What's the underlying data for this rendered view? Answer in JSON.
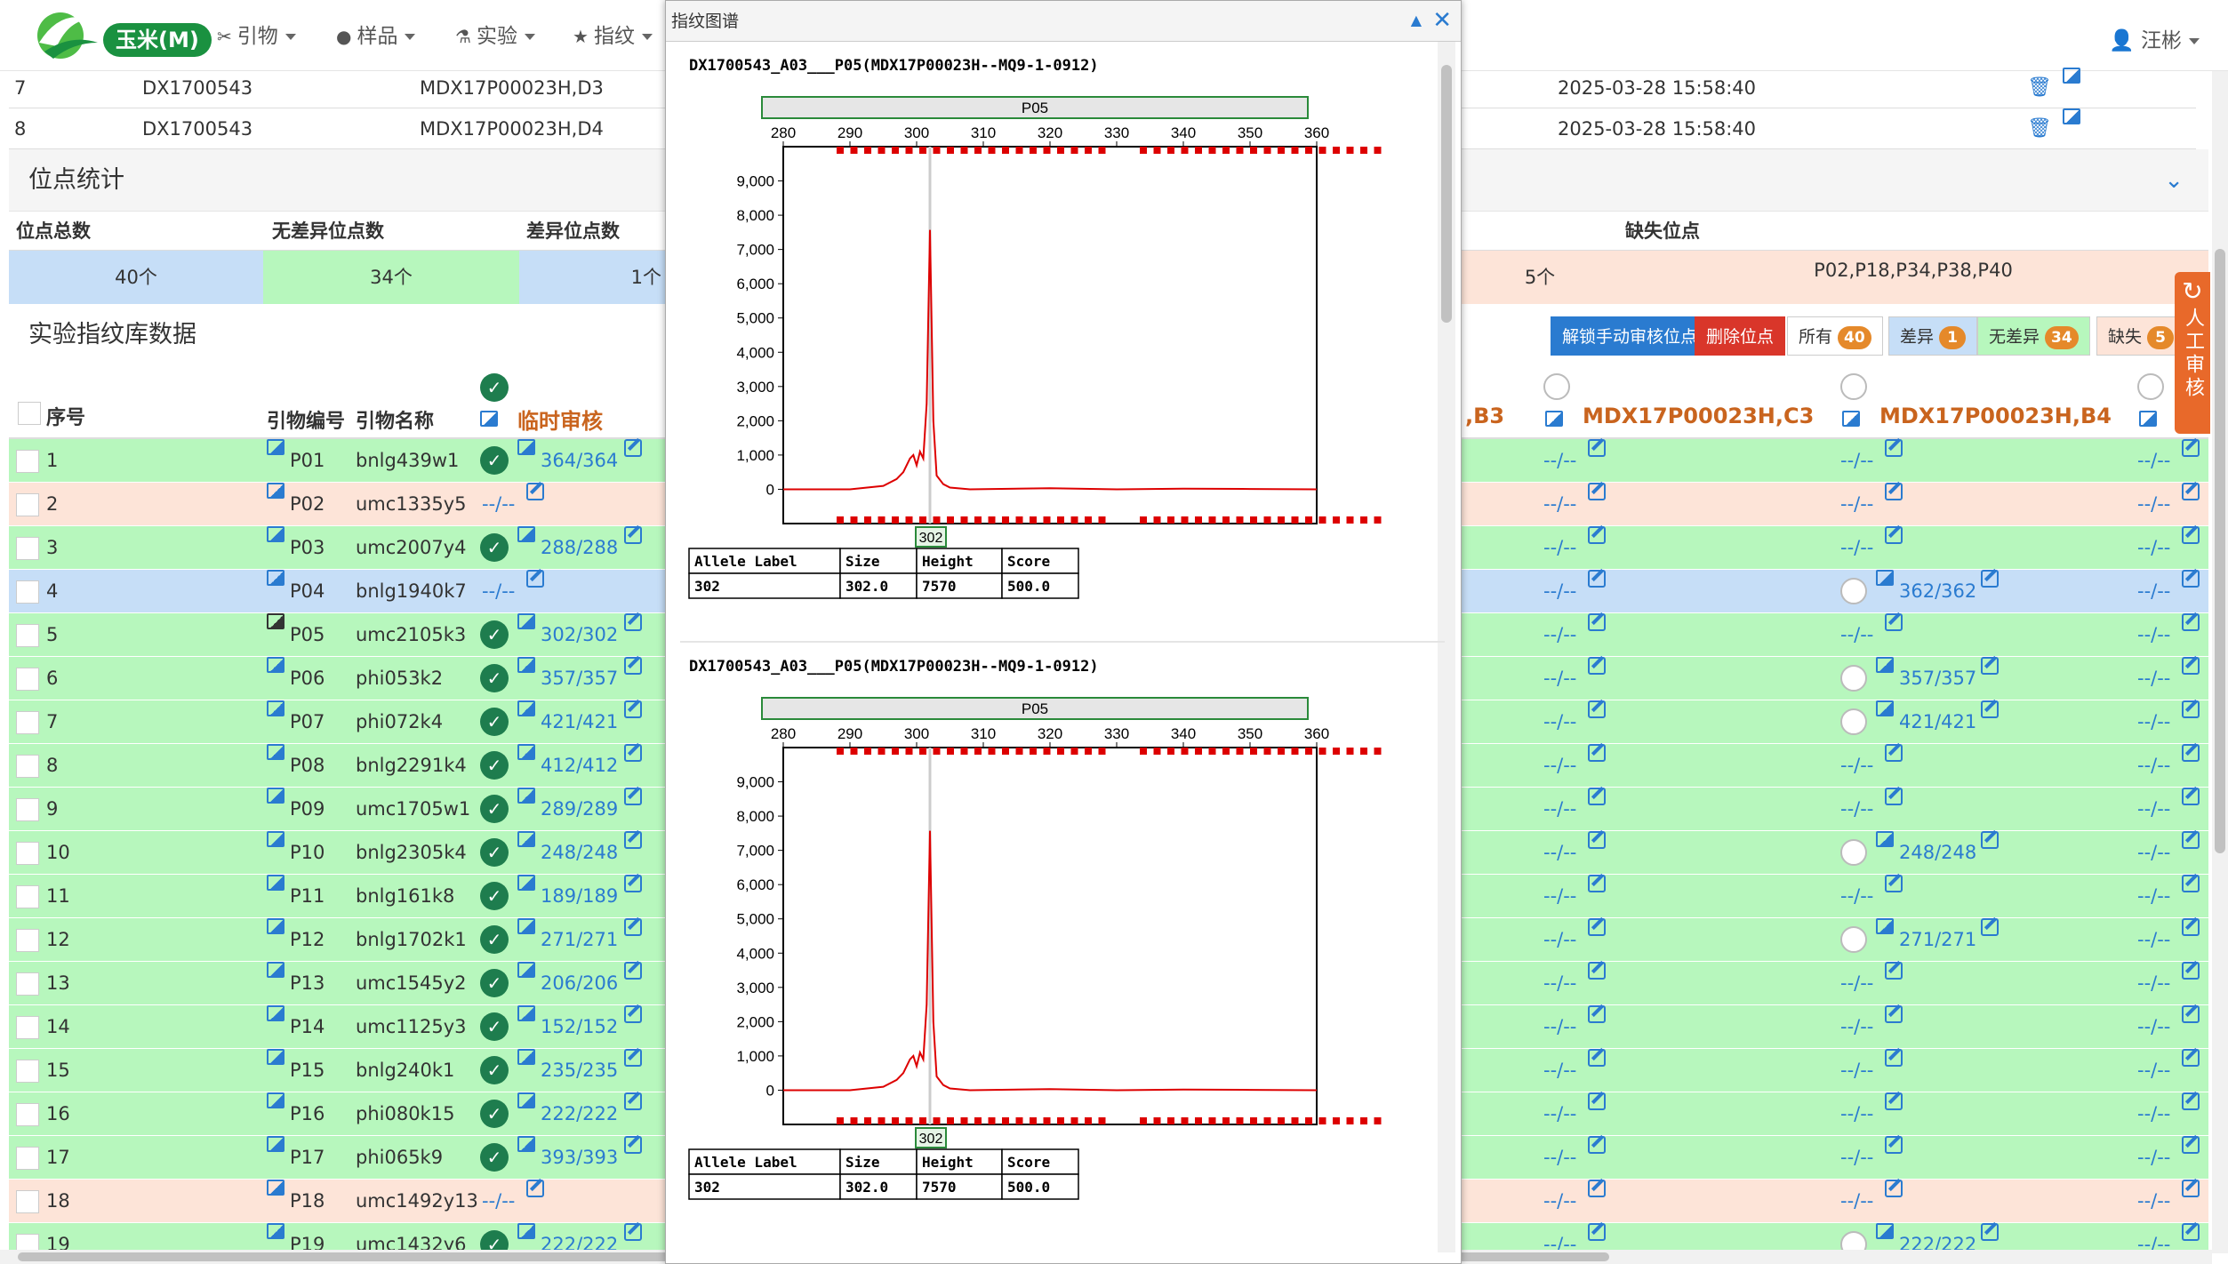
{
  "nav": {
    "brand": "玉米(M)",
    "items": [
      {
        "icon": "✂",
        "label": "引物"
      },
      {
        "icon": "●",
        "label": "样品"
      },
      {
        "icon": "⚗",
        "label": "实验"
      },
      {
        "icon": "★",
        "label": "指纹"
      }
    ],
    "user": "汪彬"
  },
  "top_rows": [
    {
      "no": "7",
      "barcode": "DX1700543",
      "sample": "MDX17P00023H,D3",
      "time": "2025-03-28 15:58:40"
    },
    {
      "no": "8",
      "barcode": "DX1700543",
      "sample": "MDX17P00023H,D4",
      "time": "2025-03-28 15:58:40"
    }
  ],
  "locus_stats": {
    "title": "位点统计",
    "headers": {
      "total": "位点总数",
      "no_diff": "无差异位点数",
      "diff": "差异位点数",
      "missing": "缺失位点"
    },
    "values": {
      "total": "40个",
      "no_diff": "34个",
      "diff": "1个",
      "missing_count": "5个",
      "missing": "P02,P18,P34,P38,P40"
    }
  },
  "fp_section": {
    "title": "实验指纹库数据",
    "buttons": {
      "unlock": "解锁手动审核位点",
      "delete": "删除位点"
    },
    "filters": [
      {
        "label": "所有",
        "count": "40"
      },
      {
        "label": "差异",
        "count": "1"
      },
      {
        "label": "无差异",
        "count": "34"
      },
      {
        "label": "缺失",
        "count": "5"
      }
    ]
  },
  "side_button": "人工审核",
  "table": {
    "headers": {
      "no": "序号",
      "code": "引物编号",
      "name": "引物名称",
      "temp": "临时审核",
      "col_b3": ",B3",
      "col_c3": "MDX17P00023H,C3",
      "col_b4": "MDX17P00023H,B4"
    },
    "rows": [
      {
        "no": "1",
        "code": "P01",
        "name": "bnlg439w1",
        "status": "ok",
        "temp": "364/364",
        "b4": "--/--"
      },
      {
        "no": "2",
        "code": "P02",
        "name": "umc1335y5",
        "status": "missing",
        "temp": "--/--",
        "b4": "--/--"
      },
      {
        "no": "3",
        "code": "P03",
        "name": "umc2007y4",
        "status": "ok",
        "temp": "288/288",
        "b4": "--/--"
      },
      {
        "no": "4",
        "code": "P04",
        "name": "bnlg1940k7",
        "status": "diff",
        "temp": "--/--",
        "b4": "362/362"
      },
      {
        "no": "5",
        "code": "P05",
        "name": "umc2105k3",
        "status": "ok",
        "temp": "302/302",
        "b4": "--/--"
      },
      {
        "no": "6",
        "code": "P06",
        "name": "phi053k2",
        "status": "ok",
        "temp": "357/357",
        "b4": "357/357"
      },
      {
        "no": "7",
        "code": "P07",
        "name": "phi072k4",
        "status": "ok",
        "temp": "421/421",
        "b4": "421/421"
      },
      {
        "no": "8",
        "code": "P08",
        "name": "bnlg2291k4",
        "status": "ok",
        "temp": "412/412",
        "b4": "--/--"
      },
      {
        "no": "9",
        "code": "P09",
        "name": "umc1705w1",
        "status": "ok",
        "temp": "289/289",
        "b4": "--/--"
      },
      {
        "no": "10",
        "code": "P10",
        "name": "bnlg2305k4",
        "status": "ok",
        "temp": "248/248",
        "b4": "248/248"
      },
      {
        "no": "11",
        "code": "P11",
        "name": "bnlg161k8",
        "status": "ok",
        "temp": "189/189",
        "b4": "--/--"
      },
      {
        "no": "12",
        "code": "P12",
        "name": "bnlg1702k1",
        "status": "ok",
        "temp": "271/271",
        "b4": "271/271"
      },
      {
        "no": "13",
        "code": "P13",
        "name": "umc1545y2",
        "status": "ok",
        "temp": "206/206",
        "b4": "--/--"
      },
      {
        "no": "14",
        "code": "P14",
        "name": "umc1125y3",
        "status": "ok",
        "temp": "152/152",
        "b4": "--/--"
      },
      {
        "no": "15",
        "code": "P15",
        "name": "bnlg240k1",
        "status": "ok",
        "temp": "235/235",
        "b4": "--/--"
      },
      {
        "no": "16",
        "code": "P16",
        "name": "phi080k15",
        "status": "ok",
        "temp": "222/222",
        "b4": "--/--"
      },
      {
        "no": "17",
        "code": "P17",
        "name": "phi065k9",
        "status": "ok",
        "temp": "393/393",
        "b4": "--/--"
      },
      {
        "no": "18",
        "code": "P18",
        "name": "umc1492y13",
        "status": "missing",
        "temp": "--/--",
        "b4": "--/--"
      },
      {
        "no": "19",
        "code": "P19",
        "name": "umc1432y6",
        "status": "ok",
        "temp": "222/222",
        "b4": "222/222"
      }
    ],
    "empty_cell": "--/--"
  },
  "colors": {
    "ok": "#b7f7bd",
    "missing": "#fde4d8",
    "diff": "#c6def7",
    "accent": "#2a7bd0",
    "temp_header": "#c9641e"
  },
  "dialog": {
    "title": "指纹图谱",
    "panels": [
      {
        "heading": "DX1700543_A03___P05(MDX17P00023H--MQ9-1-0912)",
        "bin_label": "P05",
        "peak_label": "302",
        "table": {
          "headers": [
            "Allele Label",
            "Size",
            "Height",
            "Score"
          ],
          "row": [
            "302",
            "302.0",
            "7570",
            "500.0"
          ]
        }
      },
      {
        "heading": "DX1700543_A03___P05(MDX17P00023H--MQ9-1-0912)",
        "bin_label": "P05",
        "peak_label": "302",
        "table": {
          "headers": [
            "Allele Label",
            "Size",
            "Height",
            "Score"
          ],
          "row": [
            "302",
            "302.0",
            "7570",
            "500.0"
          ]
        }
      }
    ],
    "chart_data": {
      "type": "line",
      "x_ticks": [
        280,
        290,
        300,
        310,
        320,
        330,
        340,
        350,
        360
      ],
      "y_ticks": [
        "0",
        "1,000",
        "2,000",
        "3,000",
        "4,000",
        "5,000",
        "6,000",
        "7,000",
        "8,000",
        "9,000"
      ],
      "xlim": [
        280,
        360
      ],
      "ylim": [
        -1000,
        10000
      ],
      "x": [
        280,
        290,
        295,
        297,
        298,
        299,
        299.5,
        300,
        300.5,
        301,
        301.5,
        302,
        302.5,
        303,
        304,
        305,
        308,
        320,
        330,
        340,
        350,
        360
      ],
      "y": [
        0,
        0,
        100,
        300,
        500,
        900,
        1000,
        700,
        1100,
        900,
        2500,
        7570,
        2000,
        400,
        150,
        50,
        0,
        30,
        0,
        20,
        10,
        0
      ]
    }
  }
}
